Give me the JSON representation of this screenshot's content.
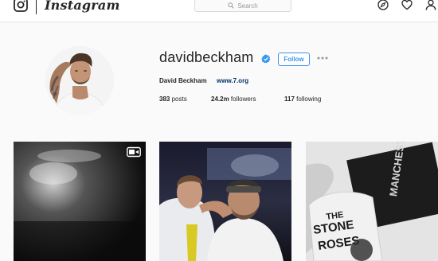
{
  "header": {
    "wordmark": "Instagram",
    "search_placeholder": "Search",
    "icons": [
      "camera-logo-icon",
      "compass-icon",
      "heart-icon",
      "person-icon"
    ]
  },
  "profile": {
    "username": "davidbeckham",
    "verified": true,
    "follow_label": "Follow",
    "full_name": "David Beckham",
    "website": "www.7.org",
    "stats": {
      "posts_count": "383",
      "posts_label": "posts",
      "followers_count": "24.2m",
      "followers_label": "followers",
      "following_count": "117",
      "following_label": "following"
    }
  },
  "posts": [
    {
      "type": "video",
      "icon": "video-icon"
    },
    {
      "type": "photo"
    },
    {
      "type": "photo",
      "visible_text": [
        "MANCHESTER",
        "THE STONE ROSES"
      ]
    }
  ],
  "colors": {
    "accent": "#3897f0",
    "link": "#003569",
    "verified": "#3897f0",
    "background": "#fafafa"
  }
}
